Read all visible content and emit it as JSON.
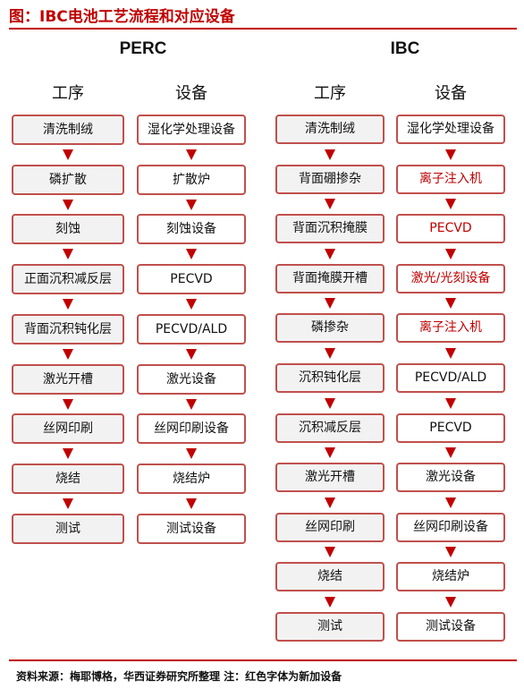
{
  "title": "图：IBC电池工艺流程和对应设备",
  "source": "资料来源：梅耶博格，华西证券研究所整理   注：红色字体为新加设备",
  "perc": {
    "heading": "PERC",
    "process_header": "工序",
    "equipment_header": "设备",
    "process": [
      "清洗制绒",
      "磷扩散",
      "刻蚀",
      "正面沉积减反层",
      "背面沉积钝化层",
      "激光开槽",
      "丝网印刷",
      "烧结",
      "测试"
    ],
    "equipment": [
      "湿化学处理设备",
      "扩散炉",
      "刻蚀设备",
      "PECVD",
      "PECVD/ALD",
      "激光设备",
      "丝网印刷设备",
      "烧结炉",
      "测试设备"
    ]
  },
  "ibc": {
    "heading": "IBC",
    "process_header": "工序",
    "equipment_header": "设备",
    "process": [
      "清洗制绒",
      "背面硼掺杂",
      "背面沉积掩膜",
      "背面掩膜开槽",
      "磷掺杂",
      "沉积钝化层",
      "沉积减反层",
      "激光开槽",
      "丝网印刷",
      "烧结",
      "测试"
    ],
    "equipment": [
      "湿化学处理设备",
      "离子注入机",
      "PECVD",
      "激光/光刻设备",
      "离子注入机",
      "PECVD/ALD",
      "PECVD",
      "激光设备",
      "丝网印刷设备",
      "烧结炉",
      "测试设备"
    ],
    "new_equipment": [
      false,
      true,
      true,
      true,
      true,
      false,
      false,
      false,
      false,
      false,
      false
    ]
  },
  "colors": {
    "accent": "#c00000",
    "border": "#c0504d"
  }
}
